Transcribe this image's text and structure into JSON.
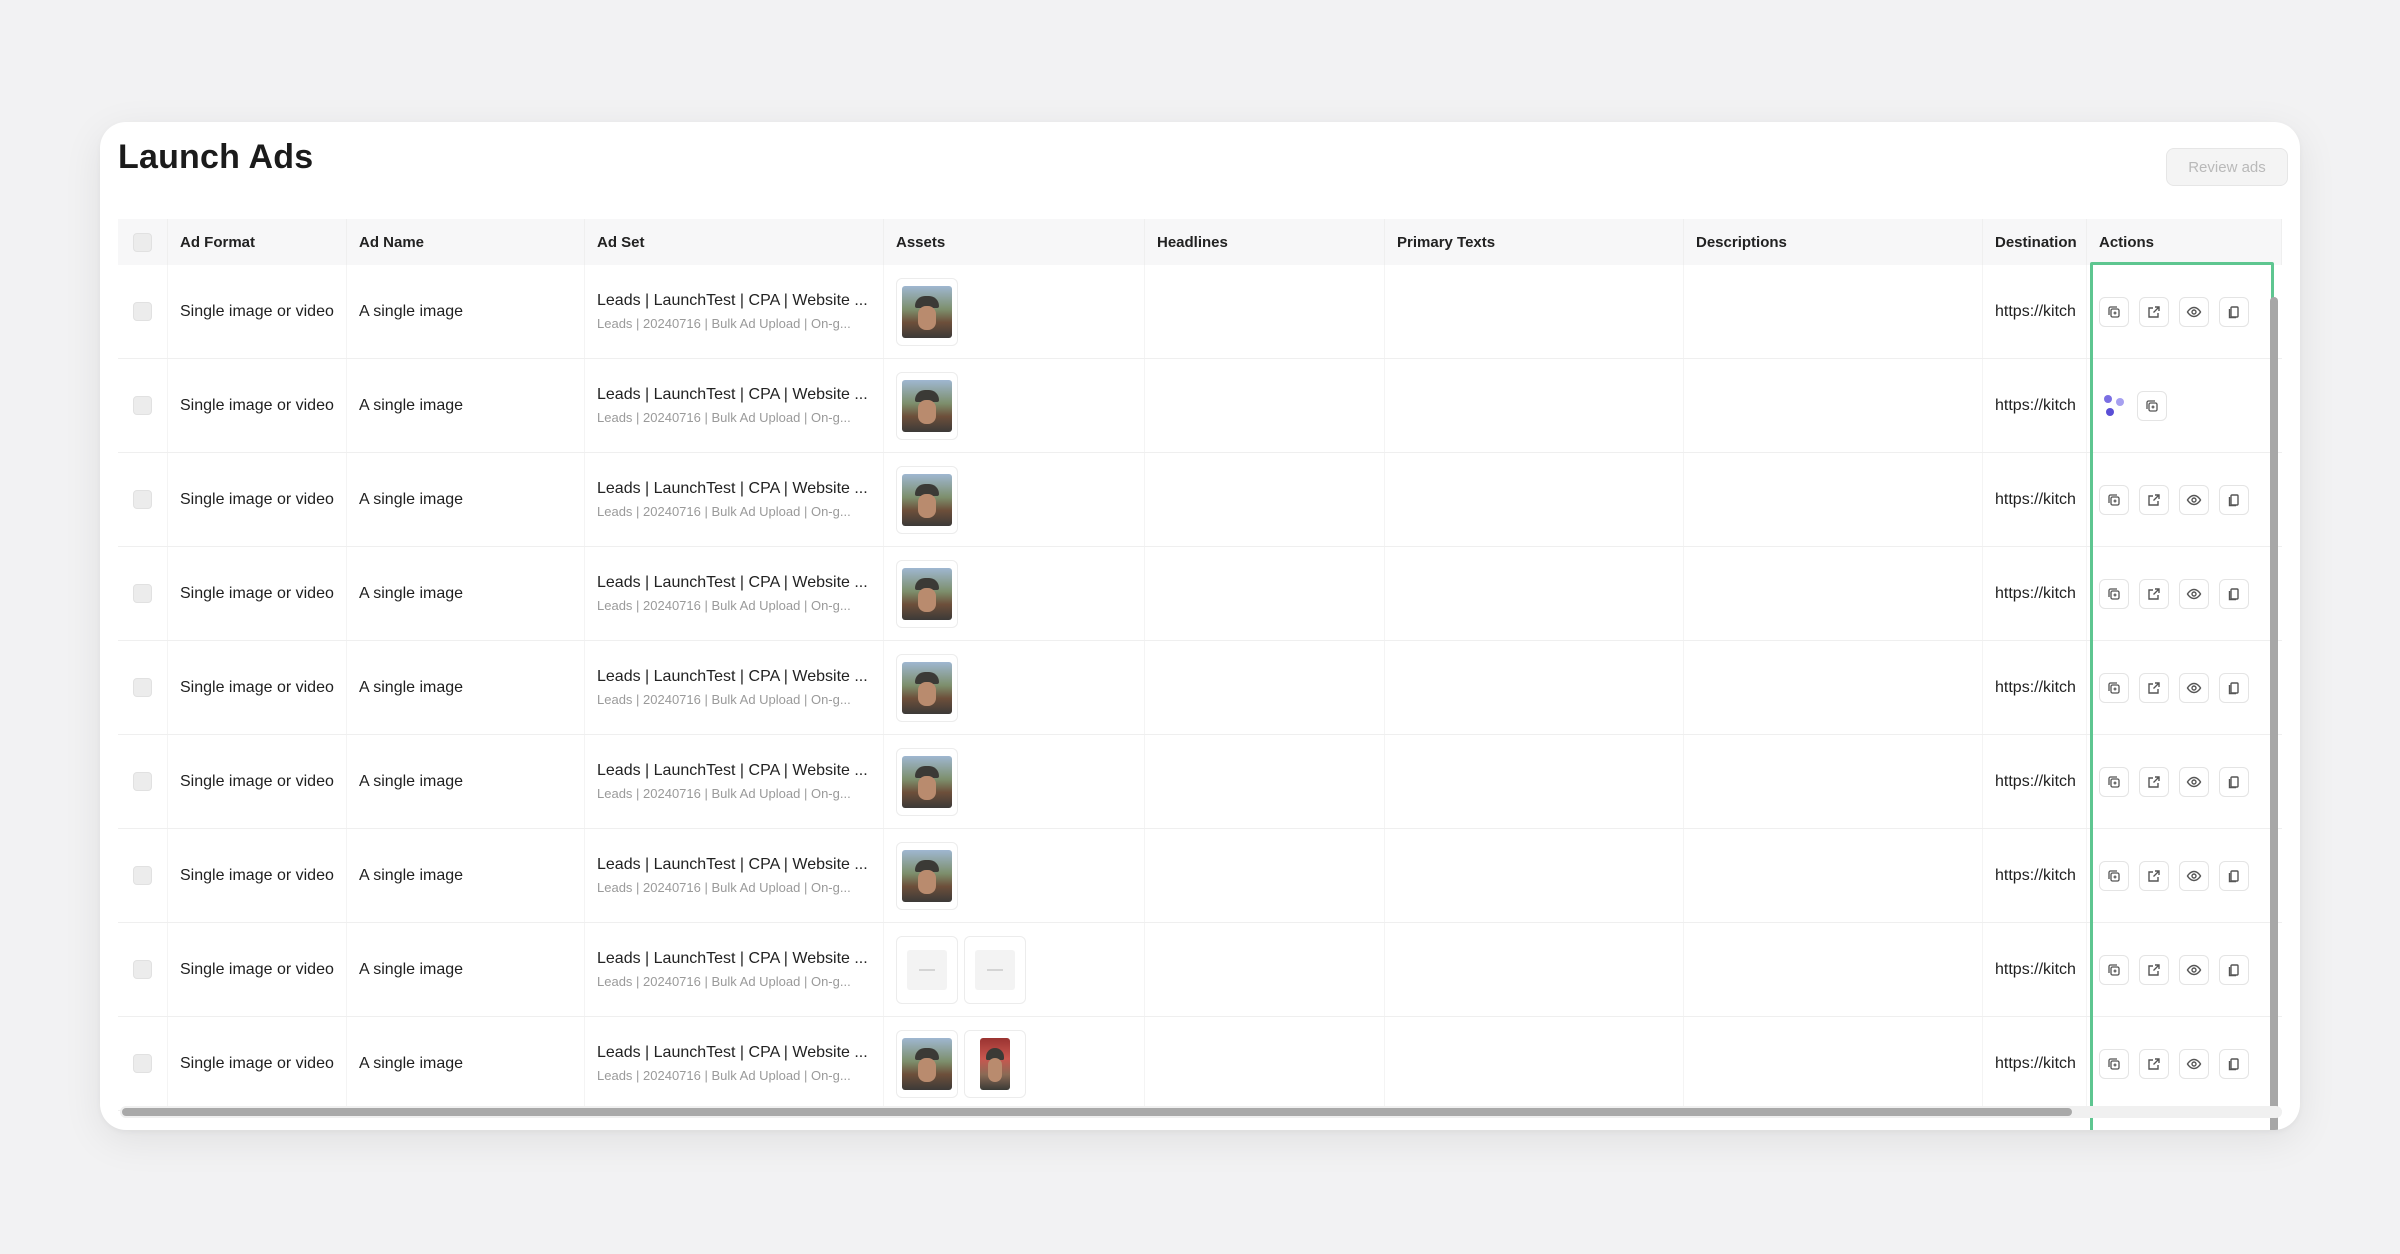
{
  "page": {
    "title": "Launch Ads",
    "review_button": "Review ads"
  },
  "colors": {
    "highlight": "#5ec690",
    "loading_dots": [
      "#7b6fe3",
      "#a6a0f0",
      "#5a4fd6"
    ]
  },
  "table": {
    "columns": [
      "Ad Format",
      "Ad Name",
      "Ad Set",
      "Assets",
      "Headlines",
      "Primary Texts",
      "Descriptions",
      "Destination",
      "Actions"
    ],
    "rows": [
      {
        "ad_format": "Single image or video",
        "ad_name": "A single image",
        "ad_set_main": "Leads | LaunchTest | CPA | Website ...",
        "ad_set_sub": "Leads | 20240716 | Bulk Ad Upload | On-g...",
        "assets": [
          "person-photo"
        ],
        "destination": "https://kitch",
        "state": "ready"
      },
      {
        "ad_format": "Single image or video",
        "ad_name": "A single image",
        "ad_set_main": "Leads | LaunchTest | CPA | Website ...",
        "ad_set_sub": "Leads | 20240716 | Bulk Ad Upload | On-g...",
        "assets": [
          "person-photo"
        ],
        "destination": "https://kitch",
        "state": "loading"
      },
      {
        "ad_format": "Single image or video",
        "ad_name": "A single image",
        "ad_set_main": "Leads | LaunchTest | CPA | Website ...",
        "ad_set_sub": "Leads | 20240716 | Bulk Ad Upload | On-g...",
        "assets": [
          "person-photo"
        ],
        "destination": "https://kitch",
        "state": "ready"
      },
      {
        "ad_format": "Single image or video",
        "ad_name": "A single image",
        "ad_set_main": "Leads | LaunchTest | CPA | Website ...",
        "ad_set_sub": "Leads | 20240716 | Bulk Ad Upload | On-g...",
        "assets": [
          "person-photo"
        ],
        "destination": "https://kitch",
        "state": "ready"
      },
      {
        "ad_format": "Single image or video",
        "ad_name": "A single image",
        "ad_set_main": "Leads | LaunchTest | CPA | Website ...",
        "ad_set_sub": "Leads | 20240716 | Bulk Ad Upload | On-g...",
        "assets": [
          "person-photo"
        ],
        "destination": "https://kitch",
        "state": "ready"
      },
      {
        "ad_format": "Single image or video",
        "ad_name": "A single image",
        "ad_set_main": "Leads | LaunchTest | CPA | Website ...",
        "ad_set_sub": "Leads | 20240716 | Bulk Ad Upload | On-g...",
        "assets": [
          "person-photo"
        ],
        "destination": "https://kitch",
        "state": "ready"
      },
      {
        "ad_format": "Single image or video",
        "ad_name": "A single image",
        "ad_set_main": "Leads | LaunchTest | CPA | Website ...",
        "ad_set_sub": "Leads | 20240716 | Bulk Ad Upload | On-g...",
        "assets": [
          "person-photo"
        ],
        "destination": "https://kitch",
        "state": "ready"
      },
      {
        "ad_format": "Single image or video",
        "ad_name": "A single image",
        "ad_set_main": "Leads | LaunchTest | CPA | Website ...",
        "ad_set_sub": "Leads | 20240716 | Bulk Ad Upload | On-g...",
        "assets": [
          "blank",
          "blank"
        ],
        "destination": "https://kitch",
        "state": "ready"
      },
      {
        "ad_format": "Single image or video",
        "ad_name": "A single image",
        "ad_set_main": "Leads | LaunchTest | CPA | Website ...",
        "ad_set_sub": "Leads | 20240716 | Bulk Ad Upload | On-g...",
        "assets": [
          "person-photo",
          "person-photo-alt"
        ],
        "destination": "https://kitch",
        "state": "ready"
      }
    ]
  },
  "action_icons": [
    "duplicate-icon",
    "open-external-icon",
    "preview-eye-icon",
    "copy-icon"
  ]
}
